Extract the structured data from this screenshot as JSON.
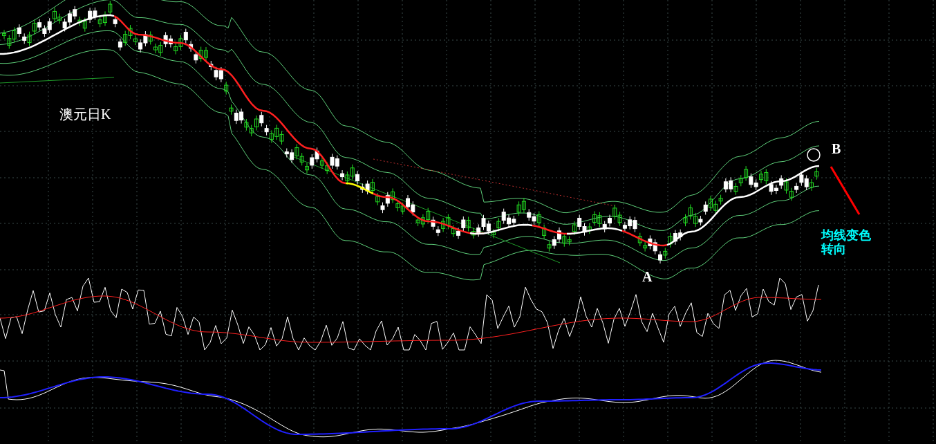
{
  "chart_title": "澳元日K",
  "labels": [
    {
      "kind": "point",
      "text": "B"
    },
    {
      "kind": "point",
      "text": "A"
    }
  ],
  "note": [
    "均线变色",
    "转向"
  ]
}
